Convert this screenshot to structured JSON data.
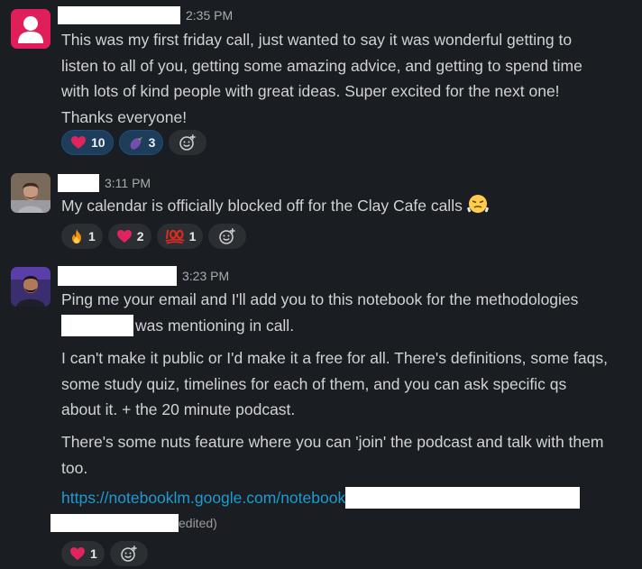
{
  "messages": [
    {
      "time": "2:35 PM",
      "lines": [
        "This was my first friday call, just wanted to say it was wonderful getting to",
        "listen to all of you, getting some amazing advice, and getting to spend time",
        "with lots of kind people with great ideas. Super excited for the next one!",
        "Thanks everyone!"
      ],
      "reactions": [
        {
          "emoji": "heart",
          "count": "10",
          "active": true
        },
        {
          "emoji": "eggplant",
          "count": "3",
          "active": true
        }
      ]
    },
    {
      "time": "3:11 PM",
      "text": "My calendar is officially blocked off for the Clay Cafe calls",
      "reactions": [
        {
          "emoji": "fire",
          "count": "1"
        },
        {
          "emoji": "heart",
          "count": "2"
        },
        {
          "emoji": "hundred",
          "count": "1"
        }
      ]
    },
    {
      "time": "3:23 PM",
      "line1": "Ping me your email and I'll add you to this notebook for the methodologies",
      "line2_after_redaction": "was mentioning in call.",
      "para2": [
        "I can't make it public or I'd make it a free for all. There's definitions, some faqs,",
        "some study quiz, timelines for each of them,  and you can ask specific qs",
        "about it. + the 20 minute podcast."
      ],
      "para3": [
        "There's some nuts feature where you can 'join' the podcast and talk with them",
        "too."
      ],
      "link": "https://notebooklm.google.com/notebook",
      "edited": "edited)",
      "reactions": [
        {
          "emoji": "heart",
          "count": "1"
        }
      ]
    }
  ],
  "colors": {
    "background": "#1a1d21",
    "text": "#d1d2d3",
    "link": "#1d9bd1",
    "reaction_active_bg": "#1d3d5a",
    "reaction_bg": "#2b2e32"
  }
}
